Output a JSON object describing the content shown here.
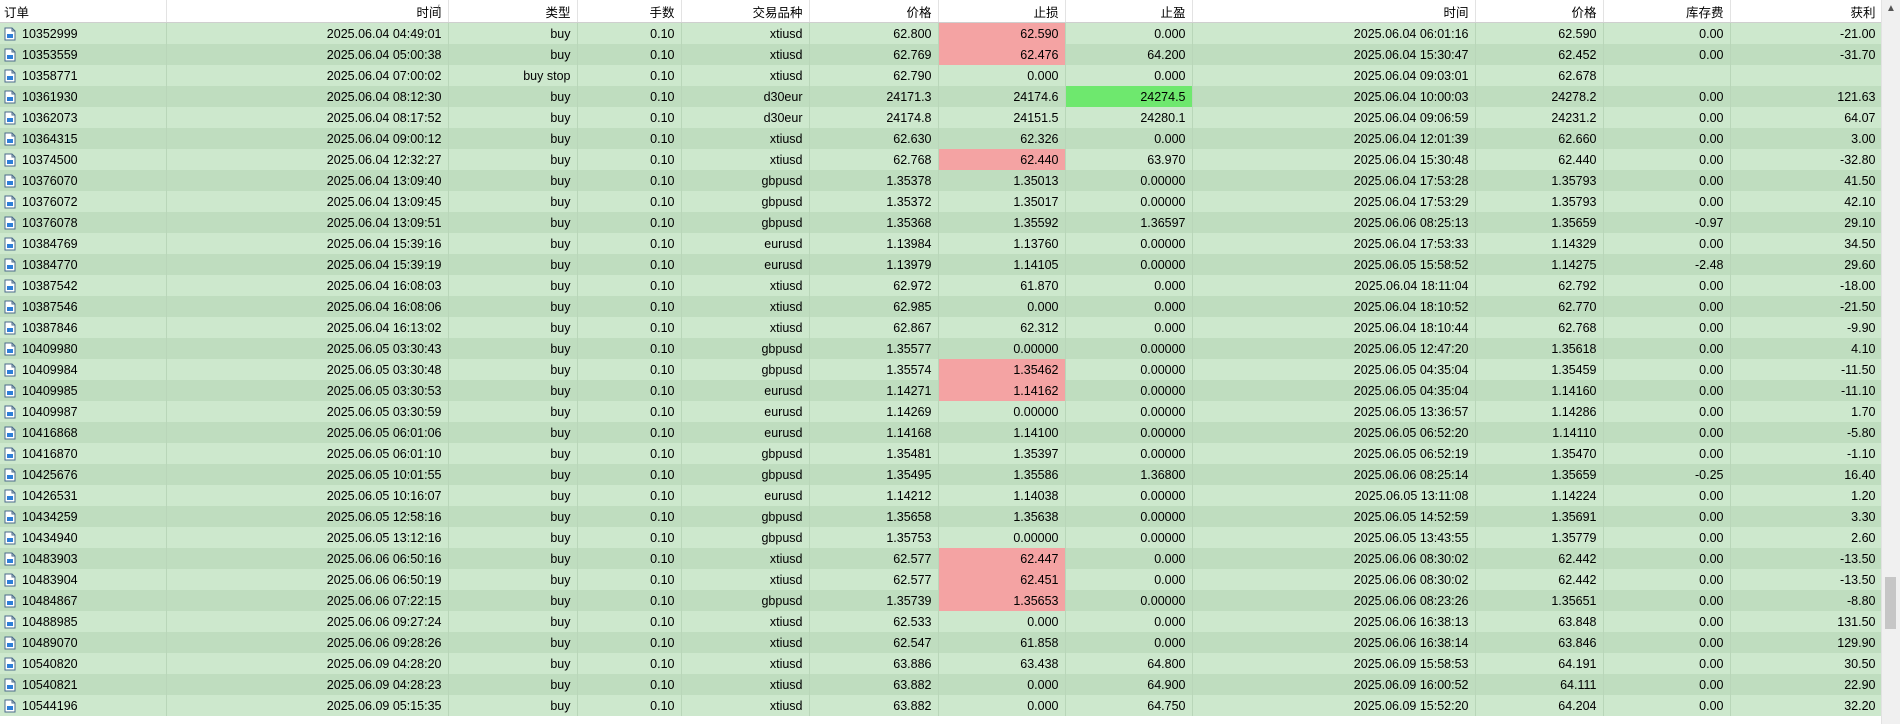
{
  "columns": [
    "订单",
    "时间",
    "类型",
    "手数",
    "交易品种",
    "价格",
    "止损",
    "止盈",
    "时间",
    "价格",
    "库存费",
    "获利"
  ],
  "sort_indicator": "/",
  "colors": {
    "row_odd": "#cde8cd",
    "row_even": "#bfddbf",
    "stop_loss_hit": "#f4a3a3",
    "take_profit_hit": "#6ee86e"
  },
  "icon": "order-document-icon",
  "rows": [
    {
      "order": "10352999",
      "open_time": "2025.06.04 04:49:01",
      "type": "buy",
      "volume": "0.10",
      "symbol": "xtiusd",
      "open_price": "62.800",
      "sl": "62.590",
      "tp": "0.000",
      "close_time": "2025.06.04 06:01:16",
      "close_price": "62.590",
      "swap": "0.00",
      "profit": "-21.00",
      "hl": "sl"
    },
    {
      "order": "10353559",
      "open_time": "2025.06.04 05:00:38",
      "type": "buy",
      "volume": "0.10",
      "symbol": "xtiusd",
      "open_price": "62.769",
      "sl": "62.476",
      "tp": "64.200",
      "close_time": "2025.06.04 15:30:47",
      "close_price": "62.452",
      "swap": "0.00",
      "profit": "-31.70",
      "hl": "sl"
    },
    {
      "order": "10358771",
      "open_time": "2025.06.04 07:00:02",
      "type": "buy stop",
      "volume": "0.10",
      "symbol": "xtiusd",
      "open_price": "62.790",
      "sl": "0.000",
      "tp": "0.000",
      "close_time": "2025.06.04 09:03:01",
      "close_price": "62.678",
      "swap": "",
      "profit": "",
      "hl": ""
    },
    {
      "order": "10361930",
      "open_time": "2025.06.04 08:12:30",
      "type": "buy",
      "volume": "0.10",
      "symbol": "d30eur",
      "open_price": "24171.3",
      "sl": "24174.6",
      "tp": "24274.5",
      "close_time": "2025.06.04 10:00:03",
      "close_price": "24278.2",
      "swap": "0.00",
      "profit": "121.63",
      "hl": "tp"
    },
    {
      "order": "10362073",
      "open_time": "2025.06.04 08:17:52",
      "type": "buy",
      "volume": "0.10",
      "symbol": "d30eur",
      "open_price": "24174.8",
      "sl": "24151.5",
      "tp": "24280.1",
      "close_time": "2025.06.04 09:06:59",
      "close_price": "24231.2",
      "swap": "0.00",
      "profit": "64.07",
      "hl": ""
    },
    {
      "order": "10364315",
      "open_time": "2025.06.04 09:00:12",
      "type": "buy",
      "volume": "0.10",
      "symbol": "xtiusd",
      "open_price": "62.630",
      "sl": "62.326",
      "tp": "0.000",
      "close_time": "2025.06.04 12:01:39",
      "close_price": "62.660",
      "swap": "0.00",
      "profit": "3.00",
      "hl": ""
    },
    {
      "order": "10374500",
      "open_time": "2025.06.04 12:32:27",
      "type": "buy",
      "volume": "0.10",
      "symbol": "xtiusd",
      "open_price": "62.768",
      "sl": "62.440",
      "tp": "63.970",
      "close_time": "2025.06.04 15:30:48",
      "close_price": "62.440",
      "swap": "0.00",
      "profit": "-32.80",
      "hl": "sl"
    },
    {
      "order": "10376070",
      "open_time": "2025.06.04 13:09:40",
      "type": "buy",
      "volume": "0.10",
      "symbol": "gbpusd",
      "open_price": "1.35378",
      "sl": "1.35013",
      "tp": "0.00000",
      "close_time": "2025.06.04 17:53:28",
      "close_price": "1.35793",
      "swap": "0.00",
      "profit": "41.50",
      "hl": ""
    },
    {
      "order": "10376072",
      "open_time": "2025.06.04 13:09:45",
      "type": "buy",
      "volume": "0.10",
      "symbol": "gbpusd",
      "open_price": "1.35372",
      "sl": "1.35017",
      "tp": "0.00000",
      "close_time": "2025.06.04 17:53:29",
      "close_price": "1.35793",
      "swap": "0.00",
      "profit": "42.10",
      "hl": ""
    },
    {
      "order": "10376078",
      "open_time": "2025.06.04 13:09:51",
      "type": "buy",
      "volume": "0.10",
      "symbol": "gbpusd",
      "open_price": "1.35368",
      "sl": "1.35592",
      "tp": "1.36597",
      "close_time": "2025.06.06 08:25:13",
      "close_price": "1.35659",
      "swap": "-0.97",
      "profit": "29.10",
      "hl": ""
    },
    {
      "order": "10384769",
      "open_time": "2025.06.04 15:39:16",
      "type": "buy",
      "volume": "0.10",
      "symbol": "eurusd",
      "open_price": "1.13984",
      "sl": "1.13760",
      "tp": "0.00000",
      "close_time": "2025.06.04 17:53:33",
      "close_price": "1.14329",
      "swap": "0.00",
      "profit": "34.50",
      "hl": ""
    },
    {
      "order": "10384770",
      "open_time": "2025.06.04 15:39:19",
      "type": "buy",
      "volume": "0.10",
      "symbol": "eurusd",
      "open_price": "1.13979",
      "sl": "1.14105",
      "tp": "0.00000",
      "close_time": "2025.06.05 15:58:52",
      "close_price": "1.14275",
      "swap": "-2.48",
      "profit": "29.60",
      "hl": ""
    },
    {
      "order": "10387542",
      "open_time": "2025.06.04 16:08:03",
      "type": "buy",
      "volume": "0.10",
      "symbol": "xtiusd",
      "open_price": "62.972",
      "sl": "61.870",
      "tp": "0.000",
      "close_time": "2025.06.04 18:11:04",
      "close_price": "62.792",
      "swap": "0.00",
      "profit": "-18.00",
      "hl": ""
    },
    {
      "order": "10387546",
      "open_time": "2025.06.04 16:08:06",
      "type": "buy",
      "volume": "0.10",
      "symbol": "xtiusd",
      "open_price": "62.985",
      "sl": "0.000",
      "tp": "0.000",
      "close_time": "2025.06.04 18:10:52",
      "close_price": "62.770",
      "swap": "0.00",
      "profit": "-21.50",
      "hl": ""
    },
    {
      "order": "10387846",
      "open_time": "2025.06.04 16:13:02",
      "type": "buy",
      "volume": "0.10",
      "symbol": "xtiusd",
      "open_price": "62.867",
      "sl": "62.312",
      "tp": "0.000",
      "close_time": "2025.06.04 18:10:44",
      "close_price": "62.768",
      "swap": "0.00",
      "profit": "-9.90",
      "hl": ""
    },
    {
      "order": "10409980",
      "open_time": "2025.06.05 03:30:43",
      "type": "buy",
      "volume": "0.10",
      "symbol": "gbpusd",
      "open_price": "1.35577",
      "sl": "0.00000",
      "tp": "0.00000",
      "close_time": "2025.06.05 12:47:20",
      "close_price": "1.35618",
      "swap": "0.00",
      "profit": "4.10",
      "hl": ""
    },
    {
      "order": "10409984",
      "open_time": "2025.06.05 03:30:48",
      "type": "buy",
      "volume": "0.10",
      "symbol": "gbpusd",
      "open_price": "1.35574",
      "sl": "1.35462",
      "tp": "0.00000",
      "close_time": "2025.06.05 04:35:04",
      "close_price": "1.35459",
      "swap": "0.00",
      "profit": "-11.50",
      "hl": "sl"
    },
    {
      "order": "10409985",
      "open_time": "2025.06.05 03:30:53",
      "type": "buy",
      "volume": "0.10",
      "symbol": "eurusd",
      "open_price": "1.14271",
      "sl": "1.14162",
      "tp": "0.00000",
      "close_time": "2025.06.05 04:35:04",
      "close_price": "1.14160",
      "swap": "0.00",
      "profit": "-11.10",
      "hl": "sl"
    },
    {
      "order": "10409987",
      "open_time": "2025.06.05 03:30:59",
      "type": "buy",
      "volume": "0.10",
      "symbol": "eurusd",
      "open_price": "1.14269",
      "sl": "0.00000",
      "tp": "0.00000",
      "close_time": "2025.06.05 13:36:57",
      "close_price": "1.14286",
      "swap": "0.00",
      "profit": "1.70",
      "hl": ""
    },
    {
      "order": "10416868",
      "open_time": "2025.06.05 06:01:06",
      "type": "buy",
      "volume": "0.10",
      "symbol": "eurusd",
      "open_price": "1.14168",
      "sl": "1.14100",
      "tp": "0.00000",
      "close_time": "2025.06.05 06:52:20",
      "close_price": "1.14110",
      "swap": "0.00",
      "profit": "-5.80",
      "hl": ""
    },
    {
      "order": "10416870",
      "open_time": "2025.06.05 06:01:10",
      "type": "buy",
      "volume": "0.10",
      "symbol": "gbpusd",
      "open_price": "1.35481",
      "sl": "1.35397",
      "tp": "0.00000",
      "close_time": "2025.06.05 06:52:19",
      "close_price": "1.35470",
      "swap": "0.00",
      "profit": "-1.10",
      "hl": ""
    },
    {
      "order": "10425676",
      "open_time": "2025.06.05 10:01:55",
      "type": "buy",
      "volume": "0.10",
      "symbol": "gbpusd",
      "open_price": "1.35495",
      "sl": "1.35586",
      "tp": "1.36800",
      "close_time": "2025.06.06 08:25:14",
      "close_price": "1.35659",
      "swap": "-0.25",
      "profit": "16.40",
      "hl": ""
    },
    {
      "order": "10426531",
      "open_time": "2025.06.05 10:16:07",
      "type": "buy",
      "volume": "0.10",
      "symbol": "eurusd",
      "open_price": "1.14212",
      "sl": "1.14038",
      "tp": "0.00000",
      "close_time": "2025.06.05 13:11:08",
      "close_price": "1.14224",
      "swap": "0.00",
      "profit": "1.20",
      "hl": ""
    },
    {
      "order": "10434259",
      "open_time": "2025.06.05 12:58:16",
      "type": "buy",
      "volume": "0.10",
      "symbol": "gbpusd",
      "open_price": "1.35658",
      "sl": "1.35638",
      "tp": "0.00000",
      "close_time": "2025.06.05 14:52:59",
      "close_price": "1.35691",
      "swap": "0.00",
      "profit": "3.30",
      "hl": ""
    },
    {
      "order": "10434940",
      "open_time": "2025.06.05 13:12:16",
      "type": "buy",
      "volume": "0.10",
      "symbol": "gbpusd",
      "open_price": "1.35753",
      "sl": "0.00000",
      "tp": "0.00000",
      "close_time": "2025.06.05 13:43:55",
      "close_price": "1.35779",
      "swap": "0.00",
      "profit": "2.60",
      "hl": ""
    },
    {
      "order": "10483903",
      "open_time": "2025.06.06 06:50:16",
      "type": "buy",
      "volume": "0.10",
      "symbol": "xtiusd",
      "open_price": "62.577",
      "sl": "62.447",
      "tp": "0.000",
      "close_time": "2025.06.06 08:30:02",
      "close_price": "62.442",
      "swap": "0.00",
      "profit": "-13.50",
      "hl": "sl"
    },
    {
      "order": "10483904",
      "open_time": "2025.06.06 06:50:19",
      "type": "buy",
      "volume": "0.10",
      "symbol": "xtiusd",
      "open_price": "62.577",
      "sl": "62.451",
      "tp": "0.000",
      "close_time": "2025.06.06 08:30:02",
      "close_price": "62.442",
      "swap": "0.00",
      "profit": "-13.50",
      "hl": "sl"
    },
    {
      "order": "10484867",
      "open_time": "2025.06.06 07:22:15",
      "type": "buy",
      "volume": "0.10",
      "symbol": "gbpusd",
      "open_price": "1.35739",
      "sl": "1.35653",
      "tp": "0.00000",
      "close_time": "2025.06.06 08:23:26",
      "close_price": "1.35651",
      "swap": "0.00",
      "profit": "-8.80",
      "hl": "sl"
    },
    {
      "order": "10488985",
      "open_time": "2025.06.06 09:27:24",
      "type": "buy",
      "volume": "0.10",
      "symbol": "xtiusd",
      "open_price": "62.533",
      "sl": "0.000",
      "tp": "0.000",
      "close_time": "2025.06.06 16:38:13",
      "close_price": "63.848",
      "swap": "0.00",
      "profit": "131.50",
      "hl": ""
    },
    {
      "order": "10489070",
      "open_time": "2025.06.06 09:28:26",
      "type": "buy",
      "volume": "0.10",
      "symbol": "xtiusd",
      "open_price": "62.547",
      "sl": "61.858",
      "tp": "0.000",
      "close_time": "2025.06.06 16:38:14",
      "close_price": "63.846",
      "swap": "0.00",
      "profit": "129.90",
      "hl": ""
    },
    {
      "order": "10540820",
      "open_time": "2025.06.09 04:28:20",
      "type": "buy",
      "volume": "0.10",
      "symbol": "xtiusd",
      "open_price": "63.886",
      "sl": "63.438",
      "tp": "64.800",
      "close_time": "2025.06.09 15:58:53",
      "close_price": "64.191",
      "swap": "0.00",
      "profit": "30.50",
      "hl": ""
    },
    {
      "order": "10540821",
      "open_time": "2025.06.09 04:28:23",
      "type": "buy",
      "volume": "0.10",
      "symbol": "xtiusd",
      "open_price": "63.882",
      "sl": "0.000",
      "tp": "64.900",
      "close_time": "2025.06.09 16:00:52",
      "close_price": "64.111",
      "swap": "0.00",
      "profit": "22.90",
      "hl": ""
    },
    {
      "order": "10544196",
      "open_time": "2025.06.09 05:15:35",
      "type": "buy",
      "volume": "0.10",
      "symbol": "xtiusd",
      "open_price": "63.882",
      "sl": "0.000",
      "tp": "64.750",
      "close_time": "2025.06.09 15:52:20",
      "close_price": "64.204",
      "swap": "0.00",
      "profit": "32.20",
      "hl": ""
    }
  ]
}
